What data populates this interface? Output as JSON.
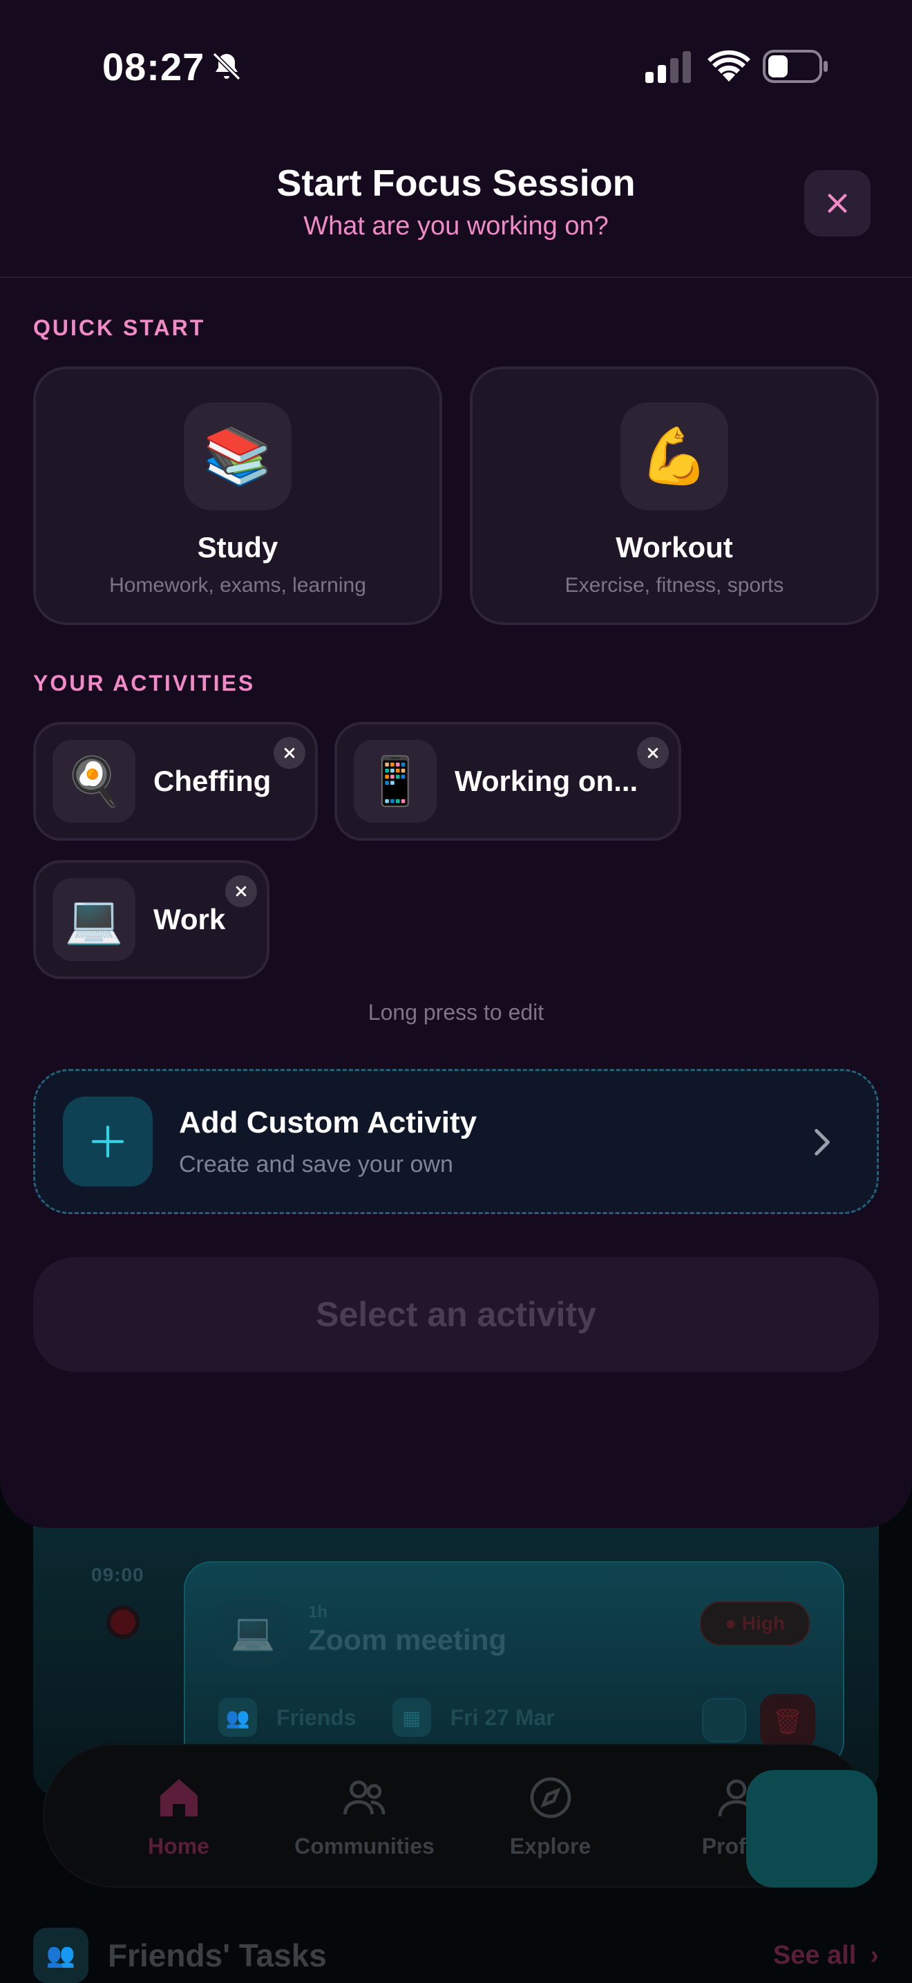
{
  "status_bar": {
    "time": "08:27"
  },
  "header": {
    "title": "Start Focus Session",
    "subtitle": "What are you working on?"
  },
  "quick_start": {
    "label": "QUICK START",
    "items": [
      {
        "icon": "📚",
        "icon_name": "books-icon",
        "title": "Study",
        "desc": "Homework, exams, learning"
      },
      {
        "icon": "💪",
        "icon_name": "flexed-biceps-icon",
        "title": "Workout",
        "desc": "Exercise, fitness, sports"
      }
    ]
  },
  "activities": {
    "label": "YOUR ACTIVITIES",
    "items": [
      {
        "icon": "🍳",
        "icon_name": "frying-pan-icon",
        "label": "Cheffing"
      },
      {
        "icon": "📱",
        "icon_name": "mobile-phone-icon",
        "label": "Working on..."
      },
      {
        "icon": "💻",
        "icon_name": "laptop-icon",
        "label": "Work"
      }
    ],
    "hint": "Long press to edit"
  },
  "add_custom": {
    "title": "Add Custom Activity",
    "subtitle": "Create and save your own"
  },
  "select_button": {
    "label": "Select an activity"
  },
  "background": {
    "timeline_time": "09:00",
    "event": {
      "small_label": "1h",
      "title": "Zoom meeting",
      "priority": "High",
      "chip_friends": "Friends",
      "chip_date": "Fri 27 Mar"
    },
    "tabs": [
      {
        "label": "Home",
        "icon_name": "home-icon"
      },
      {
        "label": "Communities",
        "icon_name": "people-icon"
      },
      {
        "label": "Explore",
        "icon_name": "compass-icon"
      },
      {
        "label": "Profile",
        "icon_name": "person-icon"
      }
    ],
    "friends_section": {
      "title": "Friends' Tasks",
      "see_all": "See all"
    }
  },
  "colors": {
    "sheet_bg": "#150a1e",
    "accent_pink": "#f28ac8",
    "accent_cyan": "#2fd3e6",
    "card_bg": "#1e1527"
  }
}
